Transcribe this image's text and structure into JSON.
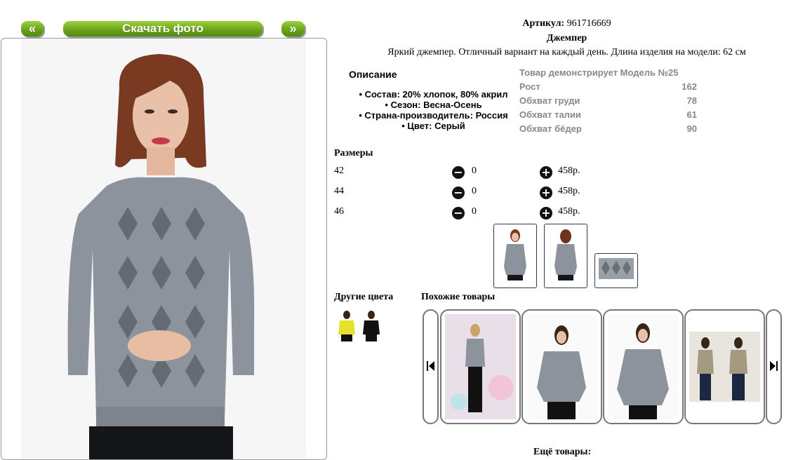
{
  "toolbar": {
    "prev_label": "«",
    "download_label": "Скачать фото",
    "next_label": "»"
  },
  "product": {
    "sku_label": "Артикул:",
    "sku_value": "961716669",
    "name": "Джемпер",
    "tagline": "Яркий джемпер. Отличный вариант на каждый день. Длина изделия на модели: 62 см"
  },
  "description": {
    "title": "Описание",
    "items": [
      "Состав: 20% хлопок, 80% акрил",
      "Сезон: Весна-Осень",
      "Страна-производитель: Россия",
      "Цвет: Серый"
    ]
  },
  "model": {
    "title": "Товар демонстрирует Модель №25",
    "rows": [
      {
        "label": "Рост",
        "value": "162"
      },
      {
        "label": "Обхват груди",
        "value": "78"
      },
      {
        "label": "Обхват талии",
        "value": "61"
      },
      {
        "label": "Обхват бёдер",
        "value": "90"
      }
    ]
  },
  "sizes": {
    "title": "Размеры",
    "rows": [
      {
        "size": "42",
        "qty": "0",
        "price": "458р."
      },
      {
        "size": "44",
        "qty": "0",
        "price": "458р."
      },
      {
        "size": "46",
        "qty": "0",
        "price": "458р."
      }
    ]
  },
  "other_colors": {
    "title": "Другие цвета",
    "swatches": [
      "yellow",
      "black"
    ]
  },
  "similar": {
    "title": "Похожие товары"
  },
  "more": {
    "title": "Ещё товары:"
  },
  "colors": {
    "green": "#6ba51c",
    "sweater_grey": "#8c939c",
    "thumb_border": "#333c55",
    "card_border": "#777777"
  }
}
